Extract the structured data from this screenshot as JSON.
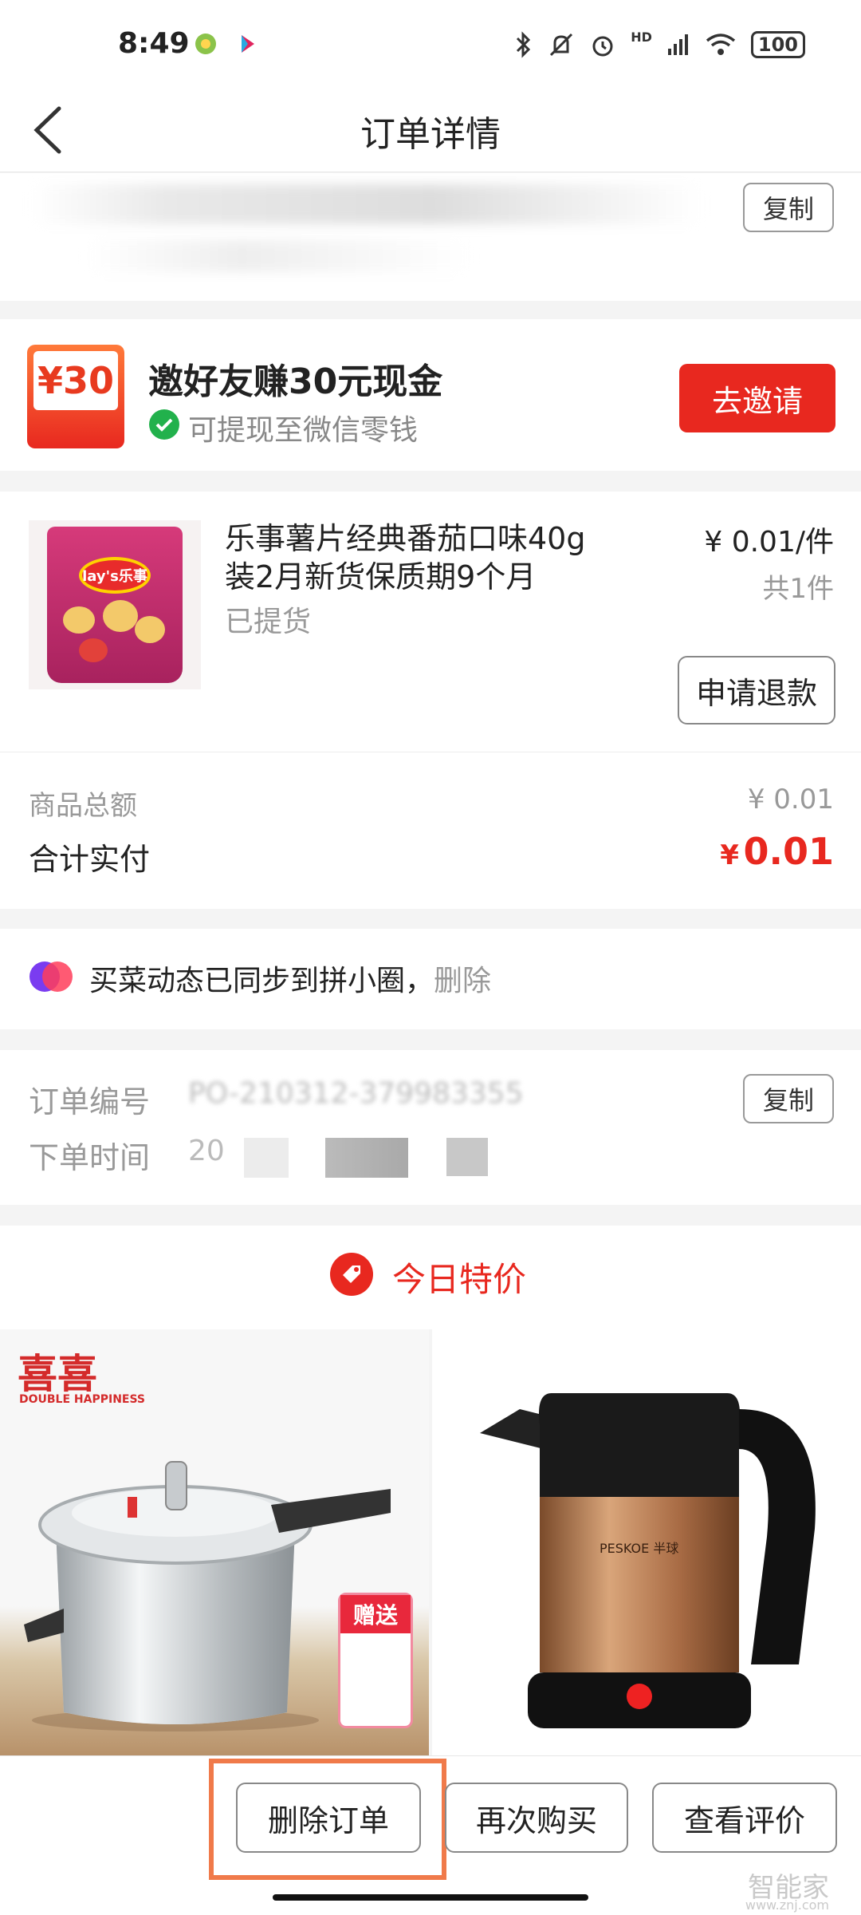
{
  "status_bar": {
    "time": "8:49",
    "battery": "100",
    "hd": "HD"
  },
  "header": {
    "title": "订单详情"
  },
  "top_card": {
    "copy_label": "复制"
  },
  "invite": {
    "coupon_text": "¥30",
    "title": "邀好友赚30元现金",
    "subtitle": "可提现至微信零钱",
    "button": "去邀请"
  },
  "product": {
    "name_line1": "乐事薯片经典番茄口味40g",
    "name_line2": "装2月新货保质期9个月",
    "status": "已提货",
    "price": "¥ 0.01/件",
    "quantity": "共1件",
    "refund_button": "申请退款",
    "image_brand": "lay's乐事"
  },
  "summary": {
    "total_label": "商品总额",
    "total_value": "¥ 0.01",
    "paid_label": "合计实付",
    "paid_currency": "¥",
    "paid_value": "0.01"
  },
  "sync": {
    "text": "买菜动态已同步到拼小圈，",
    "delete": "删除"
  },
  "order_info": {
    "number_label": "订单编号",
    "number_value": "PO-210312-379983355",
    "time_label": "下单时间",
    "time_value": "20",
    "copy_label": "复制"
  },
  "deals": {
    "title": "今日特价",
    "item1_brand": "喜喜",
    "item1_brand_en": "DOUBLE HAPPINESS",
    "item1_gift": "赠送",
    "item2_brand": "PESKOE 半球"
  },
  "actions": {
    "delete": "删除订单",
    "rebuy": "再次购买",
    "review": "查看评价"
  },
  "watermark": {
    "name": "智能家",
    "url": "www.znj.com"
  },
  "colors": {
    "accent": "#e8281f",
    "highlight": "#f07a4a"
  }
}
